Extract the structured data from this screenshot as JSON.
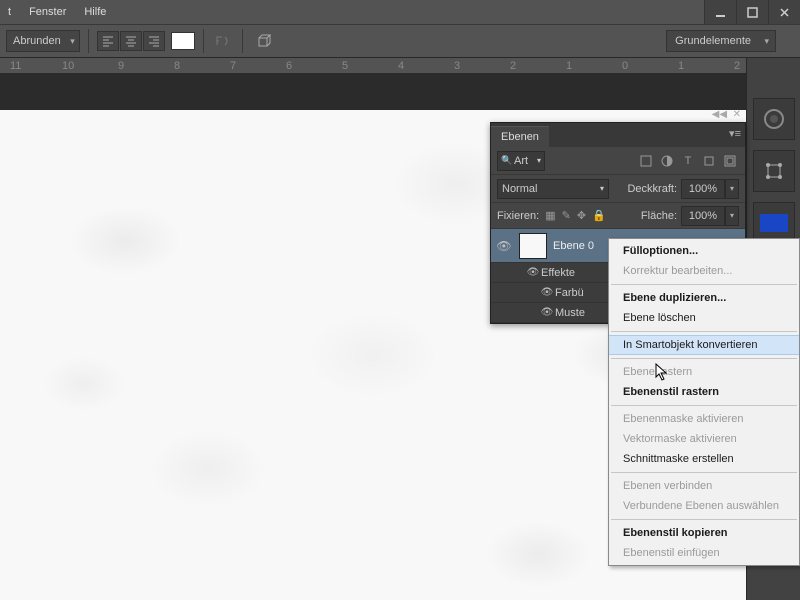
{
  "menu": {
    "items": [
      "t",
      "Fenster",
      "Hilfe"
    ]
  },
  "toolbar": {
    "shape_mode": "Abrunden",
    "grundelemente": "Grundelemente"
  },
  "ruler": [
    "11",
    "10",
    "9",
    "8",
    "7",
    "6",
    "5",
    "4",
    "3",
    "2",
    "1",
    "0",
    "1",
    "2"
  ],
  "panel": {
    "title": "Ebenen",
    "filter_kind": "Art",
    "blend_mode": "Normal",
    "opacity_label": "Deckkraft:",
    "opacity_value": "100%",
    "lock_label": "Fixieren:",
    "fill_label": "Fläche:",
    "fill_value": "100%",
    "layer_name": "Ebene 0",
    "sub_effects": "Effekte",
    "sub_color": "Farbü",
    "sub_pattern": "Muste"
  },
  "context_menu": {
    "items": [
      {
        "label": "Fülloptionen...",
        "type": "bold"
      },
      {
        "label": "Korrektur bearbeiten...",
        "type": "disabled"
      },
      {
        "type": "sep"
      },
      {
        "label": "Ebene duplizieren...",
        "type": "bold"
      },
      {
        "label": "Ebene löschen",
        "type": ""
      },
      {
        "type": "sep"
      },
      {
        "label": "In Smartobjekt konvertieren",
        "type": "hover"
      },
      {
        "type": "sep"
      },
      {
        "label": "Ebene rastern",
        "type": "disabled"
      },
      {
        "label": "Ebenenstil rastern",
        "type": "bold"
      },
      {
        "type": "sep"
      },
      {
        "label": "Ebenenmaske aktivieren",
        "type": "disabled"
      },
      {
        "label": "Vektormaske aktivieren",
        "type": "disabled"
      },
      {
        "label": "Schnittmaske erstellen",
        "type": ""
      },
      {
        "type": "sep"
      },
      {
        "label": "Ebenen verbinden",
        "type": "disabled"
      },
      {
        "label": "Verbundene Ebenen auswählen",
        "type": "disabled"
      },
      {
        "type": "sep"
      },
      {
        "label": "Ebenenstil kopieren",
        "type": "bold"
      },
      {
        "label": "Ebenenstil einfügen",
        "type": "disabled"
      }
    ]
  }
}
